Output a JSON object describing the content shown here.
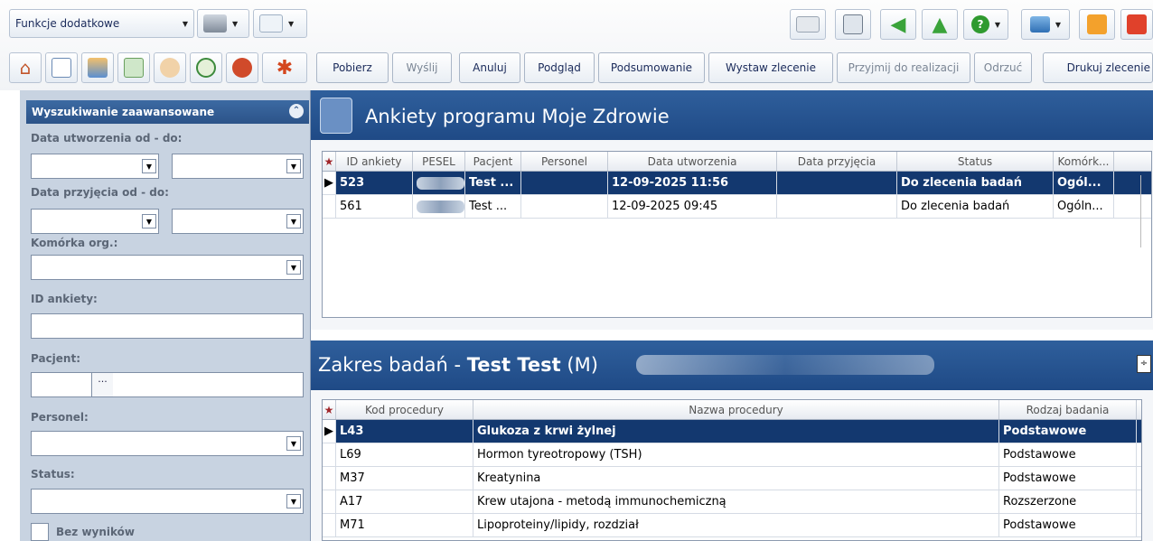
{
  "toolbar": {
    "functions_label": "Funkcje dodatkowe",
    "buttons": [
      "Pobierz",
      "Wyślij",
      "Anuluj",
      "Podgląd",
      "Podsumowanie",
      "Wystaw zlecenie",
      "Przyjmij do realizacji",
      "Odrzuć",
      "Drukuj zlecenie"
    ]
  },
  "sidebar": {
    "title": "Wyszukiwanie zaawansowane",
    "date_created_label": "Data utworzenia od - do:",
    "date_received_label": "Data przyjęcia od - do:",
    "unit_label": "Komórka org.:",
    "survey_id_label": "ID ankiety:",
    "patient_label": "Pacjent:",
    "staff_label": "Personel:",
    "status_label": "Status:",
    "no_results_label": "Bez wyników",
    "ellipsis": "..."
  },
  "surveys": {
    "title": "Ankiety programu Moje Zdrowie",
    "columns": [
      "ID ankiety",
      "PESEL",
      "Pacjent",
      "Personel",
      "Data utworzenia",
      "Data przyjęcia",
      "Status",
      "Komórk..."
    ],
    "rows": [
      {
        "id": "523",
        "patient": "Test ...",
        "staff": "",
        "created": "12-09-2025 11:56",
        "received": "",
        "status": "Do zlecenia badań",
        "unit": "Ogól..."
      },
      {
        "id": "561",
        "patient": "Test ...",
        "staff": "",
        "created": "12-09-2025 09:45",
        "received": "",
        "status": "Do zlecenia badań",
        "unit": "Ogóln..."
      }
    ]
  },
  "procedures": {
    "title_prefix": "Zakres badań - ",
    "title_name": "Test Test",
    "title_suffix": " (M)",
    "columns": [
      "Kod procedury",
      "Nazwa procedury",
      "Rodzaj badania"
    ],
    "rows": [
      {
        "code": "L43",
        "name": "Glukoza z krwi żylnej",
        "type": "Podstawowe"
      },
      {
        "code": "L69",
        "name": "Hormon tyreotropowy (TSH)",
        "type": "Podstawowe"
      },
      {
        "code": "M37",
        "name": "Kreatynina",
        "type": "Podstawowe"
      },
      {
        "code": "A17",
        "name": "Krew utajona - metodą immunochemiczną",
        "type": "Rozszerzone"
      },
      {
        "code": "M71",
        "name": "Lipoproteiny/lipidy, rozdział",
        "type": "Podstawowe"
      }
    ]
  },
  "star": "★",
  "row_pointer": "▶",
  "colors": {
    "accent": "#13386f",
    "header": "#2f5f9c",
    "sidebar": "#c8d3e1"
  }
}
